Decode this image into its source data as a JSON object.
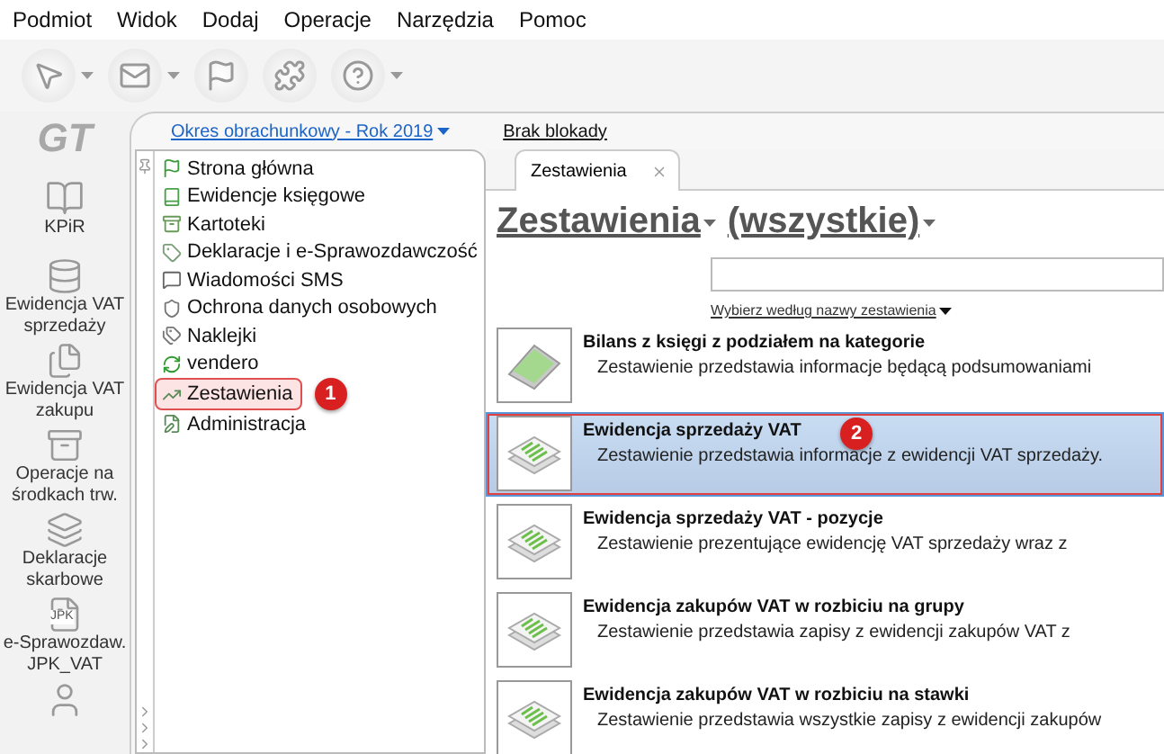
{
  "menu": [
    "Podmiot",
    "Widok",
    "Dodaj",
    "Operacje",
    "Narzędzia",
    "Pomoc"
  ],
  "toolbar": [
    {
      "kind": "cursor",
      "dropdown": true
    },
    {
      "kind": "mail",
      "dropdown": true
    },
    {
      "kind": "flag",
      "dropdown": false
    },
    {
      "kind": "puzzle",
      "dropdown": false
    },
    {
      "kind": "help",
      "dropdown": true
    }
  ],
  "logo": "GT",
  "sidebar": [
    {
      "kind": "book",
      "label": "KPiR"
    },
    {
      "kind": "coins",
      "label": "Ewidencja VAT sprzedaży"
    },
    {
      "kind": "files",
      "label": "Ewidencja VAT zakupu"
    },
    {
      "kind": "cabinet",
      "label": "Operacje na środkach trw."
    },
    {
      "kind": "layers",
      "label": "Deklaracje skarbowe"
    },
    {
      "kind": "jpk",
      "label": "e-Sprawozdaw. JPK_VAT",
      "badge": "JPK"
    },
    {
      "kind": "person"
    }
  ],
  "period": {
    "label": "Okres obrachunkowy - Rok 2019",
    "lock": "Brak blokady"
  },
  "nav_tree": {
    "items": [
      {
        "kind": "flag",
        "label": "Strona główna",
        "selected": false
      },
      {
        "kind": "book",
        "label": "Ewidencje księgowe",
        "selected": false
      },
      {
        "kind": "archive",
        "label": "Kartoteki",
        "selected": false
      },
      {
        "kind": "tag",
        "label": "Deklaracje i e-Sprawozdawczość",
        "selected": false
      },
      {
        "kind": "sms",
        "label": "Wiadomości SMS",
        "selected": false
      },
      {
        "kind": "shield",
        "label": "Ochrona danych osobowych",
        "selected": false
      },
      {
        "kind": "tags",
        "label": "Naklejki",
        "selected": false
      },
      {
        "kind": "refresh",
        "label": "vendero",
        "selected": false
      },
      {
        "kind": "chart",
        "label": "Zestawienia",
        "selected": true,
        "callout": "1"
      },
      {
        "kind": "edit",
        "label": "Administracja",
        "selected": false
      }
    ]
  },
  "tabs": [
    {
      "label": "Zestawienia",
      "selected": true
    }
  ],
  "heading": {
    "category": "Zestawienia",
    "filter": "(wszystkie)"
  },
  "sort_link": "Wybierz według nazwy zestawienia",
  "reports": [
    {
      "kind": "book",
      "title": "Bilans z księgi z podziałem na kategorie",
      "description": "Zestawienie przedstawia informacje będącą podsumowaniami",
      "selected": false
    },
    {
      "kind": "list",
      "title": "Ewidencja sprzedaży VAT",
      "description": "Zestawienie przedstawia informacje z ewidencji VAT sprzedaży.",
      "selected": true,
      "callout": "2"
    },
    {
      "kind": "list",
      "title": "Ewidencja sprzedaży VAT - pozycje",
      "description": "Zestawienie prezentujące ewidencję VAT sprzedaży wraz z",
      "selected": false
    },
    {
      "kind": "list",
      "title": "Ewidencja zakupów VAT w rozbiciu na grupy",
      "description": "Zestawienie przedstawia zapisy z ewidencji zakupów VAT z",
      "selected": false
    },
    {
      "kind": "list",
      "title": "Ewidencja zakupów VAT w rozbiciu na stawki",
      "description": "Zestawienie przedstawia wszystkie zapisy z ewidencji zakupów",
      "selected": false
    }
  ]
}
